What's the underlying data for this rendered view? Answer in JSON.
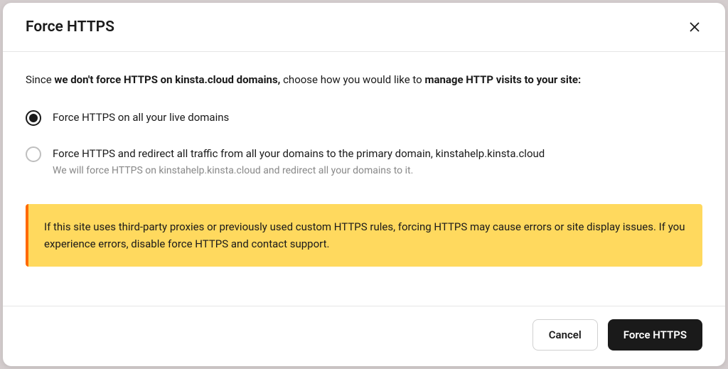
{
  "modal": {
    "title": "Force HTTPS",
    "intro": {
      "prefix": "Since ",
      "bold1": "we don't force HTTPS on kinsta.cloud domains,",
      "mid": " choose how you would like to ",
      "bold2": "manage HTTP visits to your site:"
    },
    "options": [
      {
        "label": "Force HTTPS on all your live domains",
        "helper": "",
        "selected": true
      },
      {
        "label": "Force HTTPS and redirect all traffic from all your domains to the primary domain, kinstahelp.kinsta.cloud",
        "helper": "We will force HTTPS on kinstahelp.kinsta.cloud and redirect all your domains to it.",
        "selected": false
      }
    ],
    "warning": "If this site uses third-party proxies or previously used custom HTTPS rules, forcing HTTPS may cause errors or site display issues. If you experience errors, disable force HTTPS and contact support.",
    "buttons": {
      "cancel": "Cancel",
      "confirm": "Force HTTPS"
    }
  }
}
